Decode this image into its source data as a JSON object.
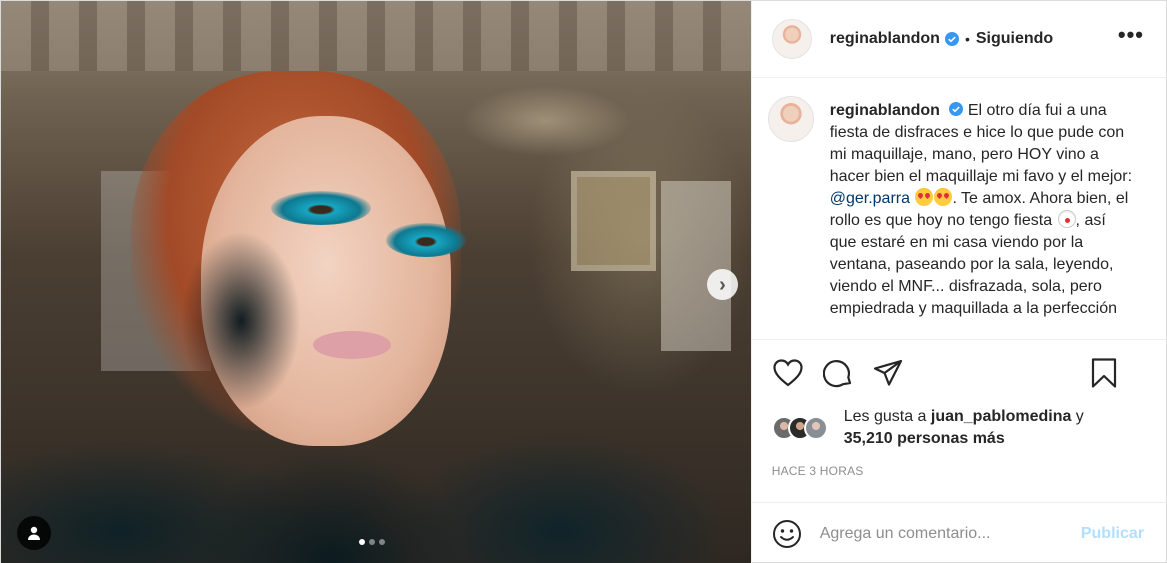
{
  "header": {
    "username": "reginablandon",
    "separator": "•",
    "follow_status": "Siguiendo",
    "more_glyph": "•••"
  },
  "caption": {
    "username": "reginablandon",
    "text_part1": "El otro día fui a una fiesta de disfraces e hice lo que pude con mi maquillaje, mano, pero HOY vino a hacer bien el maquillaje mi favo y el mejor: ",
    "mention": "@ger.parra",
    "text_part2": ". Te amox. Ahora bien, el rollo es que hoy no tengo fiesta ",
    "text_part3": ", así que estaré en mi casa viendo por la ventana, paseando por la sala, leyendo, viendo el MNF... disfrazada, sola, pero empiedrada y ",
    "text_part4": "maquillada a la perfección"
  },
  "likes": {
    "prefix": "Les gusta a ",
    "first_user": "juan_pablomedina",
    "conjunction": " y",
    "others": "35,210 personas más"
  },
  "timestamp": "HACE 3 HORAS",
  "comment": {
    "placeholder": "Agrega un comentario...",
    "publish_label": "Publicar"
  },
  "carousel": {
    "current_index": 1,
    "total": 3
  },
  "icons": {
    "header": [
      "verified-badge-icon",
      "more-options-icon"
    ],
    "actions": [
      "heart-icon",
      "comment-icon",
      "share-icon",
      "bookmark-icon"
    ],
    "media": [
      "next-arrow-icon",
      "user-tag-icon"
    ],
    "comment": [
      "emoji-icon"
    ]
  },
  "colors": {
    "verified": "#3897f0",
    "publish_disabled": "#b2dffc",
    "mention": "#00376b",
    "muted": "#8e8e8e"
  }
}
